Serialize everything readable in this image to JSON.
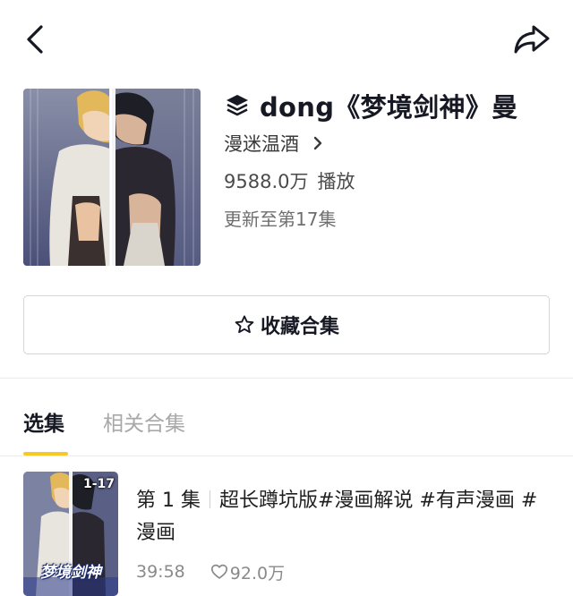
{
  "icons": {
    "back": "chevron-left-icon",
    "share": "share-arrow-icon",
    "collection": "layers-icon",
    "author_arrow": "chevron-right-icon",
    "collect": "star-icon",
    "likes": "heart-icon"
  },
  "colors": {
    "accent": "#f7c927",
    "text_primary": "#161823",
    "text_secondary": "#6f6f6f",
    "tab_inactive": "#a8a8a8"
  },
  "collection": {
    "title": "dong《梦境剑神》曼",
    "author": "漫迷温酒",
    "plays": "9588.0万",
    "plays_label": "播放",
    "update_text": "更新至第17集"
  },
  "actions": {
    "collect_label": "收藏合集"
  },
  "tabs": [
    {
      "label": "选集",
      "active": true
    },
    {
      "label": "相关合集",
      "active": false
    }
  ],
  "episodes": [
    {
      "number": "第 1 集",
      "title": "超长蹲坑版#漫画解说 #有声漫画 #漫画",
      "duration": "39:58",
      "likes": "92.0万",
      "thumb_badge": "1-17",
      "thumb_title": "梦境剑神"
    }
  ]
}
